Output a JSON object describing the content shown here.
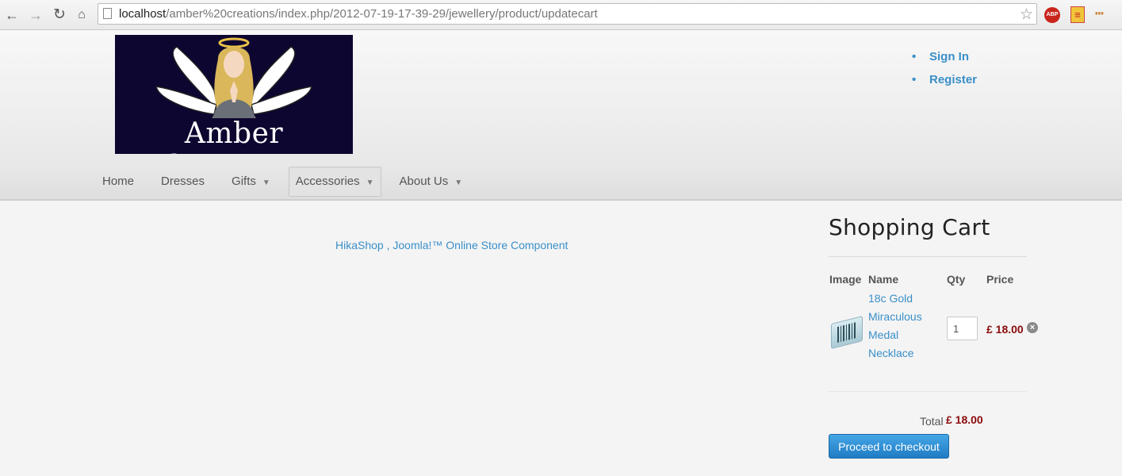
{
  "browser": {
    "url_host": "localhost",
    "url_path": "/amber%20creations/index.php/2012-07-19-17-39-29/jewellery/product/updatecart",
    "icons": [
      "back-icon",
      "forward-icon",
      "reload-icon",
      "home-icon",
      "star-icon",
      "adblock-icon",
      "extension-icon",
      "menu-icon"
    ],
    "abp_label": "ABP"
  },
  "site": {
    "logo_text": "Amber Creations",
    "user_menu": [
      "Sign In",
      "Register"
    ],
    "nav": [
      {
        "label": "Home",
        "has_caret": false
      },
      {
        "label": "Dresses",
        "has_caret": false
      },
      {
        "label": "Gifts",
        "has_caret": true
      },
      {
        "label": "Accessories",
        "has_caret": true,
        "active": true
      },
      {
        "label": "About Us",
        "has_caret": true
      }
    ]
  },
  "content": {
    "footer_link": "HikaShop , Joomla!™ Online Store Component"
  },
  "cart": {
    "title": "Shopping Cart",
    "headers": {
      "image": "Image",
      "name": "Name",
      "qty": "Qty",
      "price": "Price"
    },
    "item": {
      "name": "18c Gold Miraculous Medal Necklace",
      "qty": "1",
      "price": "£ 18.00"
    },
    "total_label": "Total",
    "total_value": "£ 18.00",
    "checkout_label": "Proceed to checkout"
  },
  "colors": {
    "link": "#3a8fc8",
    "price": "#8b0a0a",
    "button": "#2a8ad3"
  }
}
